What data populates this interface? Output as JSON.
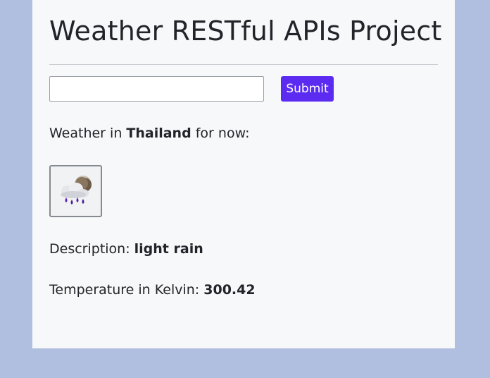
{
  "page": {
    "title": "Weather RESTful APIs Project"
  },
  "form": {
    "city_value": "",
    "submit_label": "Submit"
  },
  "weather": {
    "prefix": "Weather in ",
    "location": "Thailand",
    "suffix": " for now:",
    "icon": "light-rain-cloud-icon",
    "description_label": "Description: ",
    "description": "light rain",
    "temperature_label": "Temperature in Kelvin: ",
    "temperature": "300.42"
  },
  "colors": {
    "page_background": "#b0bfe0",
    "card_background": "#f7f8fa",
    "accent": "#5c2bf2"
  }
}
